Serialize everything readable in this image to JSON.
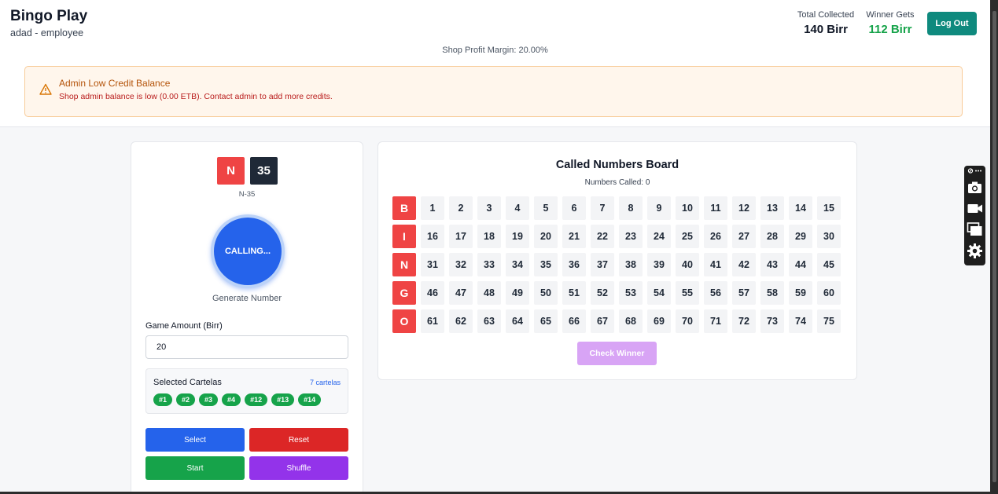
{
  "header": {
    "title": "Bingo Play",
    "subtitle": "adad - employee",
    "total_collected_label": "Total Collected",
    "total_collected_value": "140 Birr",
    "winner_gets_label": "Winner Gets",
    "winner_gets_value": "112 Birr",
    "logout_label": "Log Out",
    "profit_margin": "Shop Profit Margin: 20.00%"
  },
  "alert": {
    "icon": "warning-triangle-icon",
    "title": "Admin Low Credit Balance",
    "message": "Shop admin balance is low (0.00 ETB). Contact admin to add more credits."
  },
  "caller": {
    "letter": "N",
    "number": "35",
    "label": "N-35",
    "call_button": "CALLING...",
    "generate_label": "Generate Number"
  },
  "game": {
    "amount_label": "Game Amount (Birr)",
    "amount_value": "20"
  },
  "cartelas": {
    "title": "Selected Cartelas",
    "count": "7 cartelas",
    "items": [
      "#1",
      "#2",
      "#3",
      "#4",
      "#12",
      "#13",
      "#14"
    ]
  },
  "actions": {
    "select": "Select",
    "reset": "Reset",
    "start": "Start",
    "shuffle": "Shuffle"
  },
  "board": {
    "title": "Called Numbers Board",
    "numbers_called": "Numbers Called: 0",
    "rows": [
      {
        "letter": "B",
        "numbers": [
          "1",
          "2",
          "3",
          "4",
          "5",
          "6",
          "7",
          "8",
          "9",
          "10",
          "11",
          "12",
          "13",
          "14",
          "15"
        ]
      },
      {
        "letter": "I",
        "numbers": [
          "16",
          "17",
          "18",
          "19",
          "20",
          "21",
          "22",
          "23",
          "24",
          "25",
          "26",
          "27",
          "28",
          "29",
          "30"
        ]
      },
      {
        "letter": "N",
        "numbers": [
          "31",
          "32",
          "33",
          "34",
          "35",
          "36",
          "37",
          "38",
          "39",
          "40",
          "41",
          "42",
          "43",
          "44",
          "45"
        ]
      },
      {
        "letter": "G",
        "numbers": [
          "46",
          "47",
          "48",
          "49",
          "50",
          "51",
          "52",
          "53",
          "54",
          "55",
          "56",
          "57",
          "58",
          "59",
          "60"
        ]
      },
      {
        "letter": "O",
        "numbers": [
          "61",
          "62",
          "63",
          "64",
          "65",
          "66",
          "67",
          "68",
          "69",
          "70",
          "71",
          "72",
          "73",
          "74",
          "75"
        ]
      }
    ],
    "check_winner": "Check Winner"
  },
  "toolbar": {
    "icons": [
      "link-more-icon",
      "camera-icon",
      "video-camera-icon",
      "windows-icon",
      "gear-icon"
    ]
  },
  "colors": {
    "primary_blue": "#2563eb",
    "letter_red": "#ef4444",
    "success_green": "#16a34a",
    "teal": "#0f8a7e",
    "purple": "#9333ea",
    "alert_bg": "#fff6ec"
  }
}
